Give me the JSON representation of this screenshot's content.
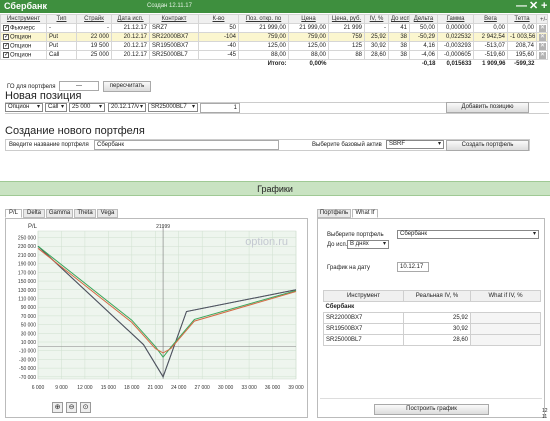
{
  "window": {
    "title": "Сбербанк",
    "created": "Создан 12.11.17",
    "buttons": [
      "—",
      "✕",
      "+"
    ]
  },
  "grid": {
    "headers": [
      "Инструмент",
      "Тип",
      "Страйк",
      "Дата исп.",
      "Контракт",
      "К-во",
      "Поз. откр. по",
      "Цена",
      "Цена, руб.",
      "IV, %",
      "До исп.",
      "Дельта",
      "Гамма",
      "Вега",
      "Тетта"
    ],
    "rows": [
      [
        "Фьючерс",
        "-",
        "-",
        "21.12.17",
        "SRZ7",
        "50",
        "21 999,00",
        "21 999,00",
        "21 999",
        "-",
        "41",
        "50,00",
        "0,000000",
        "0,00",
        "0,00"
      ],
      [
        "Опцион",
        "Put",
        "22 000",
        "20.12.17",
        "SR22000BX7",
        "-104",
        "759,00",
        "759,00",
        "759",
        "25,92",
        "38",
        "-50,29",
        "0,022532",
        "2 942,54",
        "-1 003,56"
      ],
      [
        "Опцион",
        "Put",
        "19 500",
        "20.12.17",
        "SR19500BX7",
        "-40",
        "125,00",
        "125,00",
        "125",
        "30,92",
        "38",
        "4,16",
        "-0,003293",
        "-513,07",
        "208,74"
      ],
      [
        "Опцион",
        "Call",
        "25 000",
        "20.12.17",
        "SR25000BL7",
        "-45",
        "88,00",
        "88,00",
        "88",
        "28,60",
        "38",
        "-4,06",
        "-0,000605",
        "-519,60",
        "195,60"
      ]
    ],
    "totals": {
      "label": "Итого:",
      "pct": "0,00%",
      "delta": "-0,18",
      "gamma": "0,015633",
      "vega": "1 909,96",
      "theta": "-599,32"
    },
    "plusminus": "+/-"
  },
  "go": {
    "label": "ГО для портфеля",
    "value": "—",
    "recalc": "пересчитать"
  },
  "new_position": {
    "title": "Новая позиция",
    "type": "Опцион",
    "kind": "Call",
    "strike": "25 000",
    "date": "20.12.17/v",
    "contract": "SR25000BL7",
    "qty": "1",
    "add": "Добавить позицию"
  },
  "new_portfolio": {
    "title": "Создание нового портфеля",
    "name_label": "Введите название портфеля",
    "name_value": "Сбербанк",
    "asset_label": "Выберите базовый актив",
    "asset_value": "SBRF",
    "create": "Создать портфель"
  },
  "charts_title": "Графики",
  "chart_tabs": [
    "P/L",
    "Delta",
    "Gamma",
    "Theta",
    "Vega"
  ],
  "chart_data": {
    "type": "line",
    "ylabel": "P/L",
    "watermark": "option.ru",
    "marker_label": "21999",
    "xlim": [
      6000,
      39000
    ],
    "ylim": [
      -75000,
      265000
    ],
    "x_ticks": [
      "6 000",
      "9 000",
      "12 000",
      "15 000",
      "18 000",
      "21 000",
      "24 000",
      "27 000",
      "30 000",
      "33 000",
      "36 000",
      "39 000"
    ],
    "y_ticks": [
      "250 000",
      "230 000",
      "210 000",
      "190 000",
      "170 000",
      "150 000",
      "130 000",
      "110 000",
      "90 000",
      "70 000",
      "50 000",
      "30 000",
      "10 000",
      "-10 000",
      "-30 000",
      "-50 000",
      "-70 000"
    ],
    "series": [
      {
        "color": "#3a5fc0",
        "x": [
          6000,
          19500,
          22000,
          25000,
          39000
        ],
        "y": [
          230000,
          4000,
          -70000,
          80000,
          130000
        ]
      },
      {
        "color": "#555555",
        "x": [
          6000,
          19500,
          22000,
          25000,
          39000
        ],
        "y": [
          230000,
          4000,
          -70000,
          80000,
          130000
        ]
      },
      {
        "color": "#3aa55a",
        "x": [
          6000,
          18000,
          21000,
          22000,
          23000,
          26000,
          39000
        ],
        "y": [
          230000,
          60000,
          0,
          -25000,
          -2000,
          62000,
          128000
        ]
      },
      {
        "color": "#d46b45",
        "x": [
          6000,
          18000,
          21000,
          22000,
          23000,
          26000,
          39000
        ],
        "y": [
          225000,
          55000,
          -5000,
          -15000,
          -5000,
          58000,
          126000
        ]
      }
    ]
  },
  "right_tabs": [
    "Портфель",
    "What If"
  ],
  "right": {
    "portfolio_label": "Выберите портфель",
    "portfolio_value": "Сбербанк",
    "until_label": "До исп.",
    "until_value": "В днях",
    "date_label": "График на дату",
    "date_value": "10.12.17",
    "iv_headers": [
      "Инструмент",
      "Реальная IV, %",
      "What if IV, %"
    ],
    "iv_group": "Сбербанк",
    "iv_rows": [
      [
        "SR22000BX7",
        "25,92"
      ],
      [
        "SR19500BX7",
        "30,92"
      ],
      [
        "SR25000BL7",
        "28,60"
      ]
    ],
    "build": "Построить график"
  },
  "corner_clock": "12 11"
}
